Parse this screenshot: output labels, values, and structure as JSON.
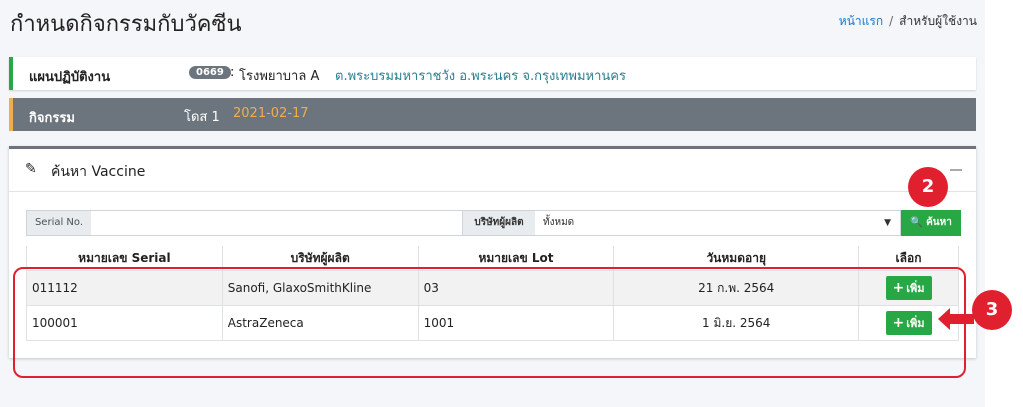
{
  "header": {
    "title": "กำหนดกิจกรรมกับวัคซีน",
    "breadcrumb_home": "หน้าแรก",
    "breadcrumb_sep": "/",
    "breadcrumb_current": "สำหรับผู้ใช้งาน"
  },
  "plan": {
    "label": "แผนปฏิบัติงาน",
    "code": "0669",
    "colon": ":",
    "hospital": "โรงพยาบาล A",
    "address": "ต.พระบรมมหาราชวัง อ.พระนคร จ.กรุงเทพมหานคร"
  },
  "activity": {
    "label": "กิจกรรม",
    "dose": "โดส 1",
    "date": "2021-02-17"
  },
  "search_card": {
    "title": "ค้นหา Vaccine",
    "serial_label": "Serial No.",
    "serial_value": "",
    "company_label": "บริษัทผู้ผลิต",
    "company_selected": "ทั้งหมด",
    "search_button": "ค้นหา"
  },
  "table": {
    "headers": [
      "หมายเลข Serial",
      "บริษัทผู้ผลิต",
      "หมายเลข Lot",
      "วันหมดอายุ",
      "เลือก"
    ],
    "rows": [
      {
        "serial": "011112",
        "company": "Sanofi, GlaxoSmithKline",
        "lot": "03",
        "expiry": "21 ก.พ. 2564",
        "action": "เพิ่ม"
      },
      {
        "serial": "100001",
        "company": "AstraZeneca",
        "lot": "1001",
        "expiry": "1 มิ.ย. 2564",
        "action": "เพิ่ม"
      }
    ]
  },
  "annotations": {
    "step_search": "2",
    "step_add": "3",
    "accent_color": "#e0202f"
  }
}
